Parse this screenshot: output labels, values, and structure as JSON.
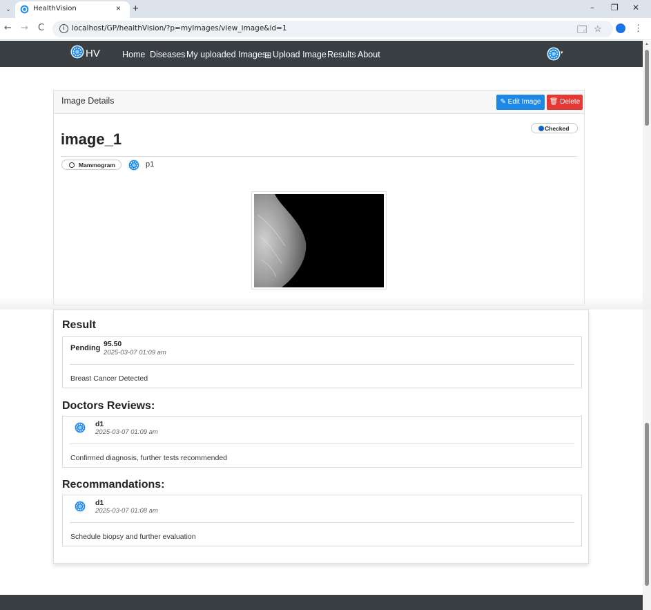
{
  "browser": {
    "tab_title": "HealthVision",
    "tab_close": "×",
    "new_tab": "+",
    "url": "localhost/GP/healthVision/?p=myImages/view_image&id=1",
    "back": "←",
    "forward": "→",
    "reload": "C",
    "minimize": "–",
    "restore": "❐",
    "close": "✕",
    "translate_icon": "🗔",
    "bookmark_star": "☆",
    "menu_dots": "⋮",
    "tab_list": "⌄"
  },
  "navbar": {
    "brand": "HV",
    "links": [
      "Home",
      "Diseases",
      "My uploaded Images",
      "Upload Image",
      "Results",
      "About"
    ],
    "upload_icon": "⊞",
    "caret": "▾"
  },
  "image_card": {
    "header_title": "Image Details",
    "edit_label": "Edit Image",
    "delete_label": "Delete",
    "edit_icon": "✎",
    "delete_icon": "🗑",
    "status": "Checked",
    "name": "image_1",
    "type": "Mammogram",
    "owner": "p1"
  },
  "result": {
    "title": "Result",
    "status": "Pending",
    "score": "95.50",
    "timestamp": "2025-03-07 01:09 am",
    "text": "Breast Cancer Detected"
  },
  "reviews": {
    "title": "Doctors Reviews:",
    "items": [
      {
        "name": "d1",
        "timestamp": "2025-03-07 01:09 am",
        "text": "Confirmed diagnosis, further tests recommended"
      }
    ]
  },
  "recommendations": {
    "title": "Recommandations:",
    "items": [
      {
        "name": "d1",
        "timestamp": "2025-03-07 01:08 am",
        "text": "Schedule biopsy and further evaluation"
      }
    ]
  },
  "colors": {
    "navbar": "#3a3f44",
    "edit_button": "#1e88e5",
    "delete_button": "#e53935",
    "checked_dot": "#1565c0"
  }
}
